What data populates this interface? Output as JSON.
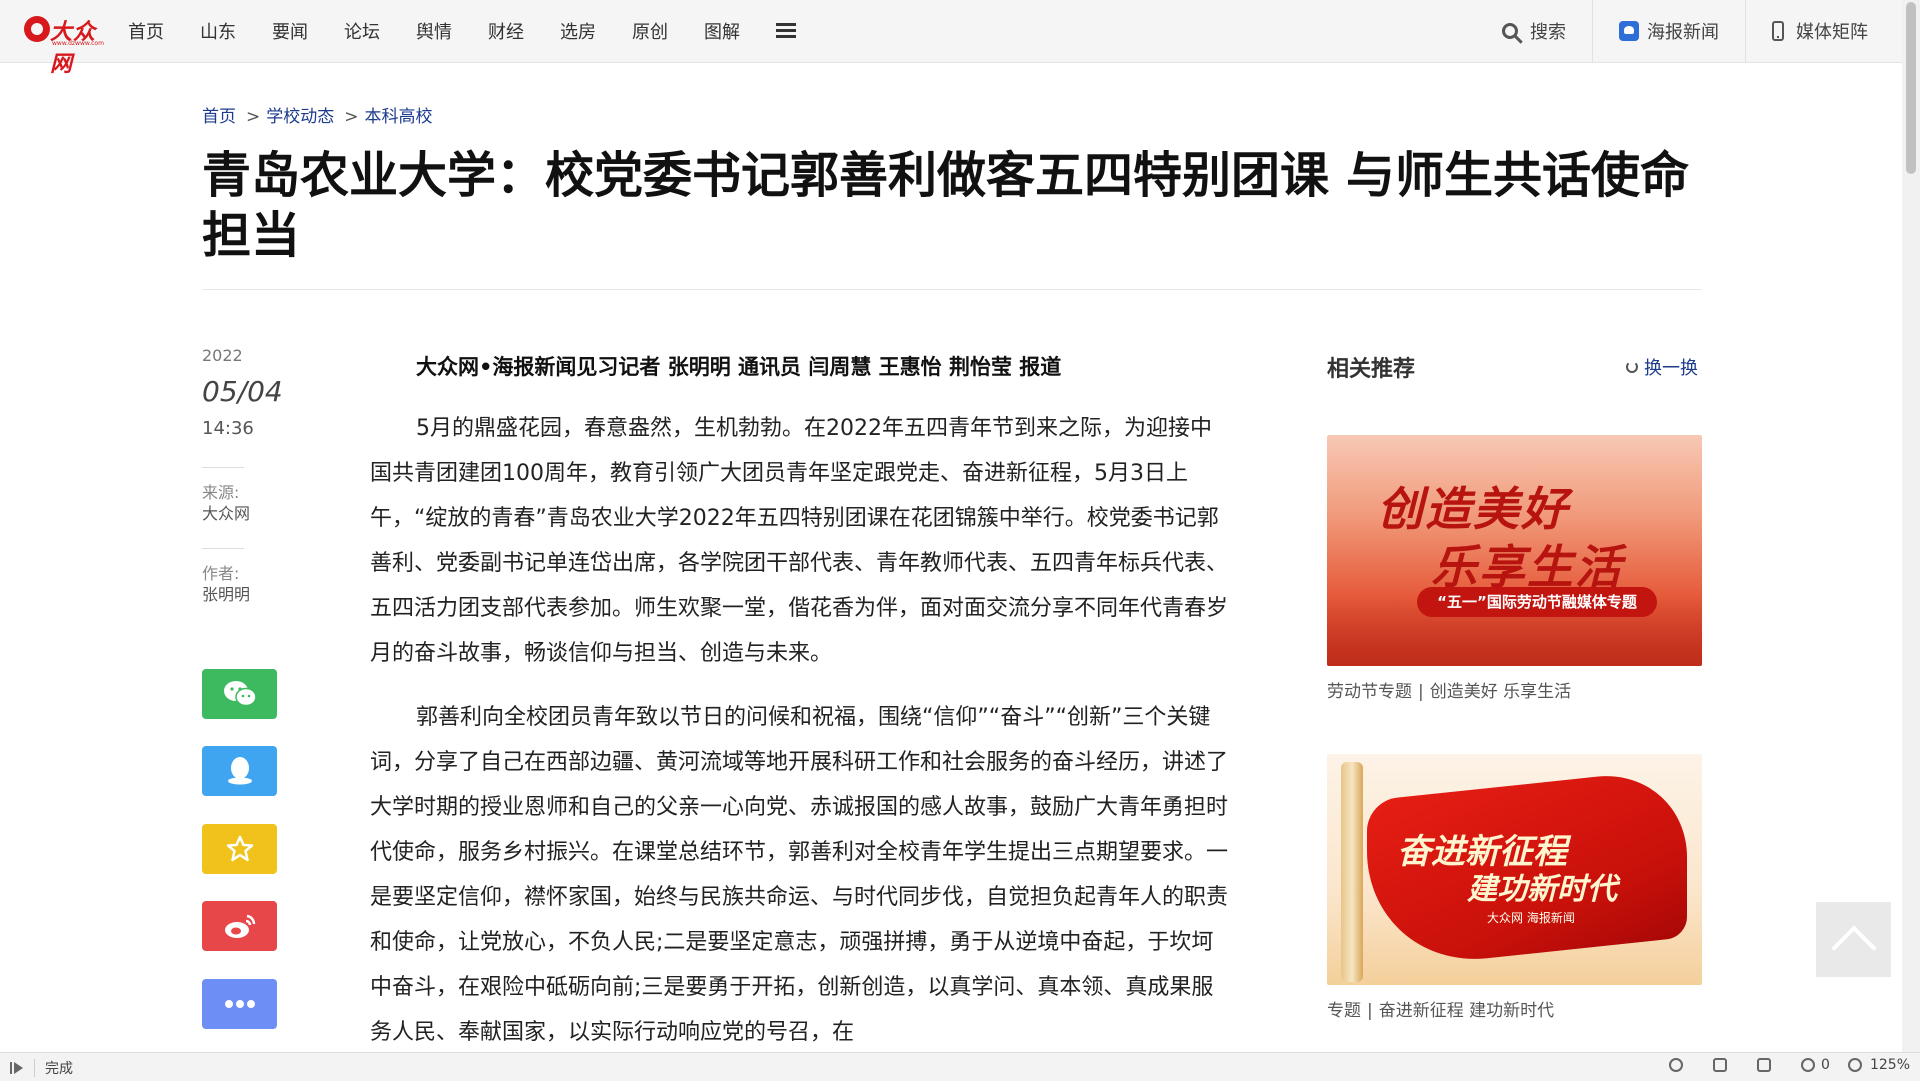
{
  "logo": {
    "text": "大众网",
    "sub": "www.dzwww.com"
  },
  "nav": {
    "items": [
      "首页",
      "山东",
      "要闻",
      "论坛",
      "舆情",
      "财经",
      "选房",
      "原创",
      "图解"
    ]
  },
  "topright": {
    "search": "搜索",
    "haibao": "海报新闻",
    "media": "媒体矩阵"
  },
  "breadcrumb": {
    "home": "首页",
    "section": "学校动态",
    "sub": "本科高校"
  },
  "article": {
    "title": "青岛农业大学：校党委书记郭善利做客五四特别团课 与师生共话使命担当",
    "byline": "大众网•海报新闻见习记者 张明明 通讯员 闫周慧 王惠怡 荆怡莹 报道",
    "paragraphs": [
      "5月的鼎盛花园，春意盎然，生机勃勃。在2022年五四青年节到来之际，为迎接中国共青团建团100周年，教育引领广大团员青年坚定跟党走、奋进新征程，5月3日上午，“绽放的青春”青岛农业大学2022年五四特别团课在花团锦簇中举行。校党委书记郭善利、党委副书记单连岱出席，各学院团干部代表、青年教师代表、五四青年标兵代表、五四活力团支部代表参加。师生欢聚一堂，偕花香为伴，面对面交流分享不同年代青春岁月的奋斗故事，畅谈信仰与担当、创造与未来。",
      "郭善利向全校团员青年致以节日的问候和祝福，围绕“信仰”“奋斗”“创新”三个关键词，分享了自己在西部边疆、黄河流域等地开展科研工作和社会服务的奋斗经历，讲述了大学时期的授业恩师和自己的父亲一心向党、赤诚报国的感人故事，鼓励广大青年勇担时代使命，服务乡村振兴。在课堂总结环节，郭善利对全校青年学生提出三点期望要求。一是要坚定信仰，襟怀家国，始终与民族共命运、与时代同步伐，自觉担负起青年人的职责和使命，让党放心，不负人民;二是要坚定意志，顽强拼搏，勇于从逆境中奋起，于坎坷中奋斗，在艰险中砥砺向前;三是要勇于开拓，创新创造，以真学问、真本领、真成果服务人民、奉献国家，以实际行动响应党的号召，在"
    ]
  },
  "meta": {
    "year": "2022",
    "date": "05/04",
    "time": "14:36",
    "source_label": "来源:",
    "source": "大众网",
    "author_label": "作者:",
    "author": "张明明"
  },
  "share": {
    "colors": {
      "wechat": "#3dba5f",
      "qq": "#3fa5f0",
      "favorite": "#f0c21b",
      "weibo": "#e8474a",
      "more": "#6c8ef5"
    }
  },
  "sidebar": {
    "title": "相关推荐",
    "refresh": "换一换",
    "cards": [
      {
        "headline1": "创造美好",
        "headline2": "乐享生活",
        "pill": "“五一”国际劳动节融媒体专题",
        "tag": "劳动节专题",
        "caption": "创造美好 乐享生活"
      },
      {
        "headline1": "奋进新征程",
        "headline2": "建功新时代",
        "brand": "大众网 海报新闻",
        "tag": "专题",
        "caption": "奋进新征程 建功新时代"
      }
    ]
  },
  "statusbar": {
    "status": "完成",
    "ad_count": "0",
    "zoom": "125%"
  },
  "colors": {
    "brand_red": "#d7181c",
    "link_blue": "#1d3b8e"
  }
}
